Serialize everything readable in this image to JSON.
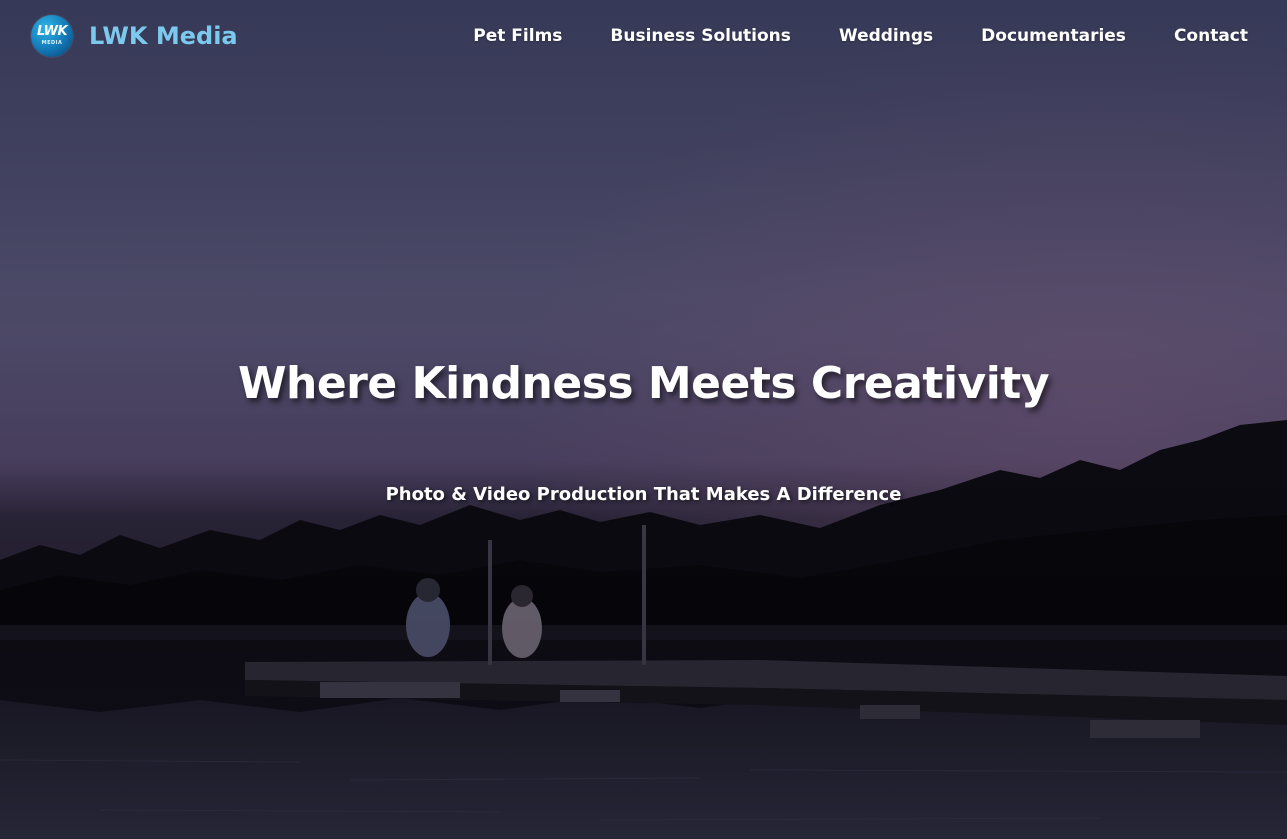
{
  "header": {
    "logo_text": "LWK",
    "logo_subtext": "MEDIA",
    "brand_name": "LWK Media",
    "brand_color": "#7cc9ee"
  },
  "nav": {
    "items": [
      {
        "label": "Pet Films"
      },
      {
        "label": "Business Solutions"
      },
      {
        "label": "Weddings"
      },
      {
        "label": "Documentaries"
      },
      {
        "label": "Contact"
      }
    ]
  },
  "hero": {
    "title": "Where Kindness Meets Creativity",
    "subtitle": "Photo & Video Production That Makes A Difference"
  }
}
